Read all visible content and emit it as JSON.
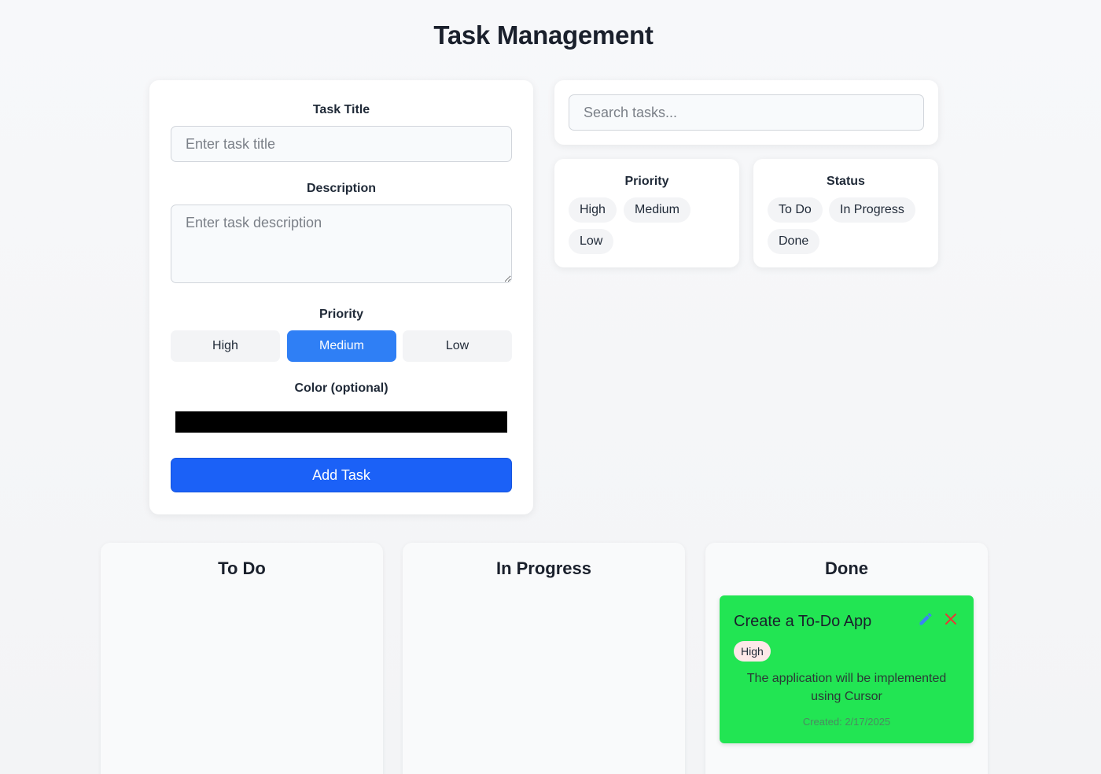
{
  "page": {
    "title": "Task Management"
  },
  "form": {
    "title_label": "Task Title",
    "title_placeholder": "Enter task title",
    "title_value": "",
    "description_label": "Description",
    "description_placeholder": "Enter task description",
    "description_value": "",
    "priority_label": "Priority",
    "priority_options": [
      "High",
      "Medium",
      "Low"
    ],
    "priority_selected": "Medium",
    "color_label": "Color (optional)",
    "color_value": "#000000",
    "submit_label": "Add Task"
  },
  "search": {
    "placeholder": "Search tasks...",
    "value": ""
  },
  "filters": {
    "priority": {
      "title": "Priority",
      "options": [
        "High",
        "Medium",
        "Low"
      ]
    },
    "status": {
      "title": "Status",
      "options": [
        "To Do",
        "In Progress",
        "Done"
      ]
    }
  },
  "columns": [
    {
      "title": "To Do",
      "tasks": []
    },
    {
      "title": "In Progress",
      "tasks": []
    },
    {
      "title": "Done",
      "tasks": [
        {
          "title": "Create a To-Do App",
          "priority": "High",
          "description": "The application will be implemented using Cursor",
          "created": "Created: 2/17/2025",
          "color": "#22e553",
          "edit_icon": "pencil-icon",
          "delete_icon": "close-icon"
        }
      ]
    }
  ],
  "colors": {
    "accent": "#1b61f7",
    "active_priority": "#2f7ff5",
    "task_card": "#22e553",
    "delete": "#e53935",
    "edit": "#3b82f6"
  }
}
